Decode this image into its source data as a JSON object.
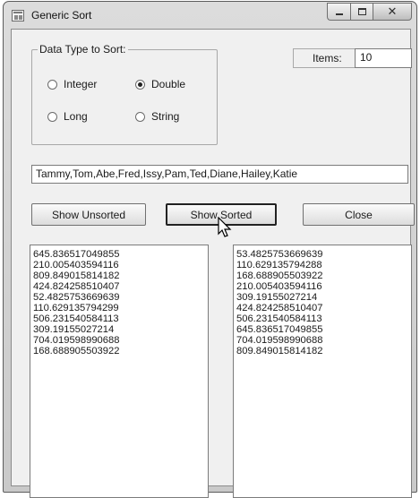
{
  "window": {
    "title": "Generic Sort",
    "controls": [
      "minimize-icon",
      "maximize-icon",
      "close-icon"
    ]
  },
  "data_type_group": {
    "label": "Data Type to Sort:",
    "options": [
      {
        "label": "Integer",
        "checked": false
      },
      {
        "label": "Double",
        "checked": true
      },
      {
        "label": "Long",
        "checked": false
      },
      {
        "label": "String",
        "checked": false
      }
    ]
  },
  "items": {
    "label": "Items:",
    "value": "10"
  },
  "names_field": {
    "value": "Tammy,Tom,Abe,Fred,Issy,Pam,Ted,Diane,Hailey,Katie"
  },
  "buttons": {
    "show_unsorted": "Show Unsorted",
    "show_sorted": "Show Sorted",
    "close": "Close"
  },
  "unsorted_list": [
    "645.836517049855",
    "210.005403594116",
    "809.849015814182",
    "424.824258510407",
    "52.4825753669639",
    "110.629135794299",
    "506.231540584113",
    "309.19155027214",
    "704.019598990688",
    "168.688905503922"
  ],
  "sorted_list": [
    "53.4825753669639",
    "110.629135794288",
    "168.688905503922",
    "210.005403594116",
    "309.19155027214",
    "424.824258510407",
    "506.231540584113",
    "645.836517049855",
    "704.019598990688",
    "809.849015814182"
  ]
}
